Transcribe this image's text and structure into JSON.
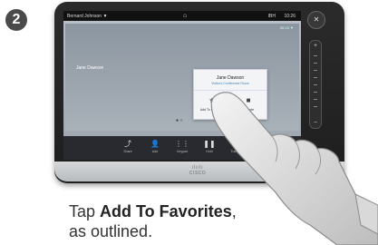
{
  "step": {
    "number": "2"
  },
  "statusbar": {
    "user": "Bernard Johnson ▼",
    "home_icon": "⌂",
    "net": "IBH",
    "time": "10:26"
  },
  "videopane": {
    "info": "00:10 ▼",
    "remote_name": "Jane Dawson"
  },
  "popup": {
    "name": "Jane Dawson",
    "subtitle": "Visitor's Conference Room",
    "buttons": [
      {
        "label": "Add To Favorites",
        "icon": "★"
      },
      {
        "label": "Remote",
        "icon": "■"
      }
    ]
  },
  "toolbar": {
    "items": [
      {
        "label": "Share",
        "icon": "⤴"
      },
      {
        "label": "Add",
        "icon": "👤"
      },
      {
        "label": "Keypad",
        "icon": "⋮⋮"
      },
      {
        "label": "Hold",
        "icon": "❚❚"
      },
      {
        "label": "Transfer",
        "icon": "+👤"
      }
    ]
  },
  "device": {
    "brand": "CISCO"
  },
  "caption": {
    "prefix": "Tap ",
    "bold": "Add To Favorites",
    "suffix": ",",
    "line2": "as outlined."
  },
  "colors": {
    "end_call": "#c82d2d",
    "screen_bg": "#9ca4ad"
  }
}
